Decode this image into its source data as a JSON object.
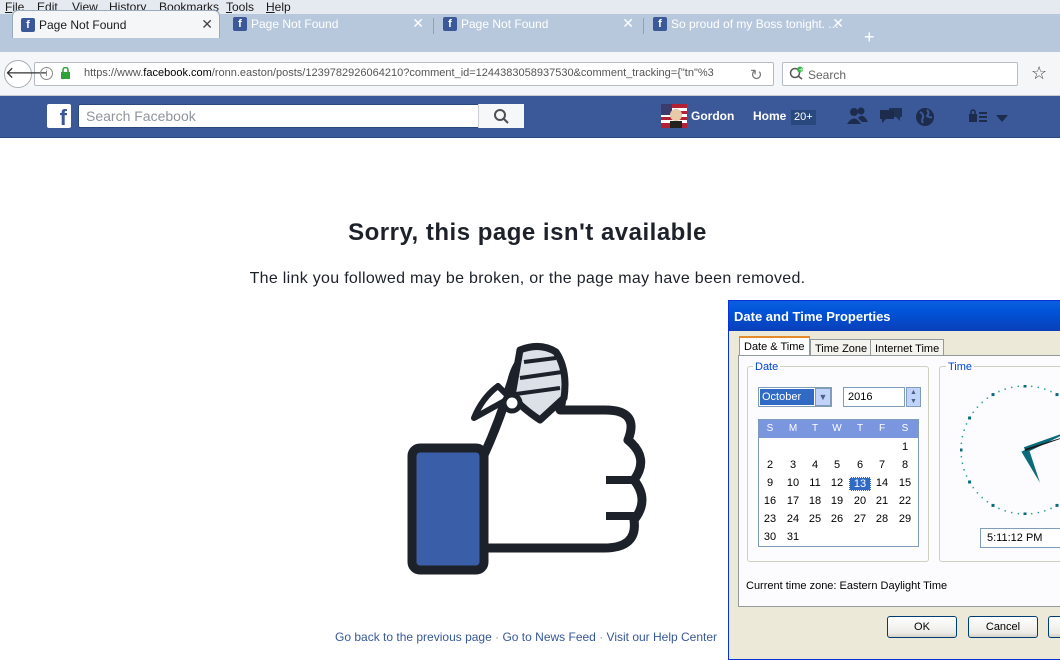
{
  "menu": [
    "File",
    "Edit",
    "View",
    "History",
    "Bookmarks",
    "Tools",
    "Help"
  ],
  "tabs": [
    {
      "title": "Page Not Found",
      "active": true
    },
    {
      "title": "Page Not Found",
      "active": false
    },
    {
      "title": "Page Not Found",
      "active": false
    },
    {
      "title": "So proud of my Boss tonight. ...",
      "active": false
    }
  ],
  "new_tab_symbol": "+",
  "url": {
    "prefix": "https://www.",
    "domain": "facebook.com",
    "path": "/ronn.easton/posts/1239782926064210?comment_id=1244383058937530&comment_tracking={\"tn\"%3"
  },
  "browser_search": {
    "placeholder": "Search"
  },
  "facebook": {
    "search_placeholder": "Search Facebook",
    "logo": "f",
    "user_name": "Gordon",
    "home_label": "Home",
    "home_badge": "20+"
  },
  "error": {
    "title": "Sorry, this page isn't available",
    "message": "The link you followed may be broken, or the page may have been removed."
  },
  "footer_links": [
    "Go back to the previous page",
    "Go to News Feed",
    "Visit our Help Center"
  ],
  "footer_separator": "·",
  "dialog": {
    "title": "Date and Time Properties",
    "tabs": [
      "Date & Time",
      "Time Zone",
      "Internet Time"
    ],
    "date_group": "Date",
    "time_group": "Time",
    "month": "October",
    "year": "2016",
    "weekdays": [
      "S",
      "M",
      "T",
      "W",
      "T",
      "F",
      "S"
    ],
    "days": [
      "1",
      "2",
      "3",
      "4",
      "5",
      "6",
      "7",
      "8",
      "9",
      "10",
      "11",
      "12",
      "13",
      "14",
      "15",
      "16",
      "17",
      "18",
      "19",
      "20",
      "21",
      "22",
      "23",
      "24",
      "25",
      "26",
      "27",
      "28",
      "29",
      "30",
      "31"
    ],
    "first_weekday_index": 6,
    "selected_day": "13",
    "time": "5:11:12 PM",
    "timezone_label": "Current time zone:",
    "timezone": "Eastern Daylight Time",
    "ok": "OK",
    "cancel": "Cancel"
  },
  "colors": {
    "facebook_blue": "#3b5998",
    "xp_title": "#0a5fe0",
    "link": "#365899"
  },
  "icons": [
    "back-arrow-icon",
    "info-icon",
    "lock-icon",
    "reload-icon",
    "search-icon",
    "star-icon",
    "facebook-favicon",
    "friends-icon",
    "messages-icon",
    "globe-icon",
    "privacy-lock-icon",
    "dropdown-caret-icon",
    "broken-thumbs-up-icon"
  ]
}
